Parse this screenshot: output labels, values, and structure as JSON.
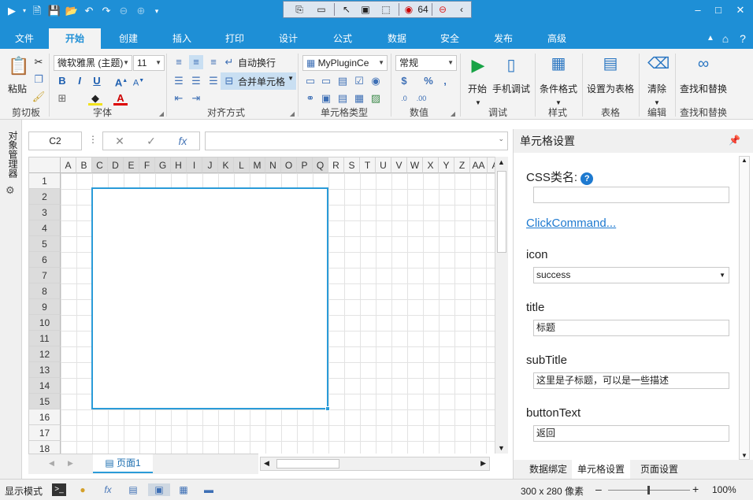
{
  "ribbon_tabs": [
    "文件",
    "开始",
    "创建",
    "插入",
    "打印",
    "设计",
    "公式",
    "数据",
    "安全",
    "发布",
    "高级"
  ],
  "center_toolbar": {
    "badge_count": "64"
  },
  "groups": {
    "clipboard": {
      "label": "剪切板",
      "paste": "粘贴"
    },
    "font": {
      "label": "字体",
      "font_name": "微软雅黑 (主题)",
      "font_size": "11",
      "bold": "B",
      "italic": "I",
      "underline": "U"
    },
    "align": {
      "label": "对齐方式",
      "wrap": "自动换行",
      "merge": "合并单元格"
    },
    "celltype": {
      "label": "单元格类型",
      "plugin": "MyPluginCe"
    },
    "number": {
      "label": "数值",
      "format": "常规"
    },
    "debug": {
      "label": "调试",
      "start": "开始",
      "mobile": "手机调试"
    },
    "style": {
      "label": "样式",
      "conditional": "条件格式"
    },
    "table": {
      "label": "表格",
      "set_table": "设置为表格"
    },
    "edit": {
      "label": "编辑",
      "clear": "清除"
    },
    "find": {
      "label": "查找和替换",
      "find_replace": "查找和替换"
    }
  },
  "left_strip": {
    "title": "对象管理器"
  },
  "formula_bar": {
    "cell_ref": "C2",
    "fx": "fx"
  },
  "sheet": {
    "columns": [
      "A",
      "B",
      "C",
      "D",
      "E",
      "F",
      "G",
      "H",
      "I",
      "J",
      "K",
      "L",
      "M",
      "N",
      "O",
      "P",
      "Q",
      "R",
      "S",
      "T",
      "U",
      "V",
      "W",
      "X",
      "Y",
      "Z",
      "AA",
      "A"
    ],
    "rows": [
      "1",
      "2",
      "3",
      "4",
      "5",
      "6",
      "7",
      "8",
      "9",
      "10",
      "11",
      "12",
      "13",
      "14",
      "15",
      "16",
      "17",
      "18"
    ],
    "tab": "页面1"
  },
  "panel": {
    "title": "单元格设置",
    "css_label": "CSS类名:",
    "click_command": "ClickCommand...",
    "icon_label": "icon",
    "icon_value": "success",
    "title_label": "title",
    "title_value": "标题",
    "subtitle_label": "subTitle",
    "subtitle_value": "这里是子标题，可以是一些描述",
    "buttontext_label": "buttonText",
    "buttontext_value": "返回",
    "tabs": [
      "数据绑定",
      "单元格设置",
      "页面设置"
    ]
  },
  "status": {
    "mode": "显示模式",
    "size": "300 x 280 像素",
    "zoom": "100%"
  },
  "colors": {
    "accent": "#1e8fd6",
    "selection": "#2a9bd8"
  }
}
